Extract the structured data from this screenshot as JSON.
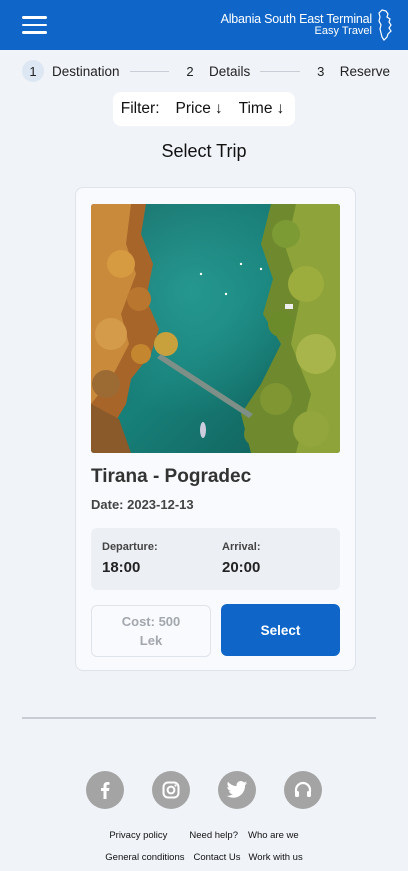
{
  "header": {
    "brand_title": "Albania South East Terminal",
    "brand_subtitle": "Easy Travel",
    "color": "#0f66c8"
  },
  "stepper": {
    "steps": [
      {
        "num": "1",
        "label": "Destination",
        "active": true
      },
      {
        "num": "2",
        "label": "Details",
        "active": false
      },
      {
        "num": "3",
        "label": "Reserve",
        "active": false
      }
    ]
  },
  "filter": {
    "label": "Filter:",
    "price": "Price",
    "time": "Time",
    "arrow": "↓"
  },
  "page_title": "Select Trip",
  "trip": {
    "route": "Tirana - Pogradec",
    "date": "Date: 2023-12-13",
    "departure_label": "Departure:",
    "departure_time": "18:00",
    "arrival_label": "Arrival:",
    "arrival_time": "20:00",
    "cost": "Cost: 500 Lek",
    "select_label": "Select"
  },
  "footer": {
    "socials": [
      "facebook-icon",
      "instagram-icon",
      "twitter-icon",
      "headset-icon"
    ],
    "links_row1": [
      "Privacy policy",
      "Need help?",
      "Who are we"
    ],
    "links_row2": [
      "General conditions",
      "Contact Us",
      "Work with us"
    ]
  }
}
